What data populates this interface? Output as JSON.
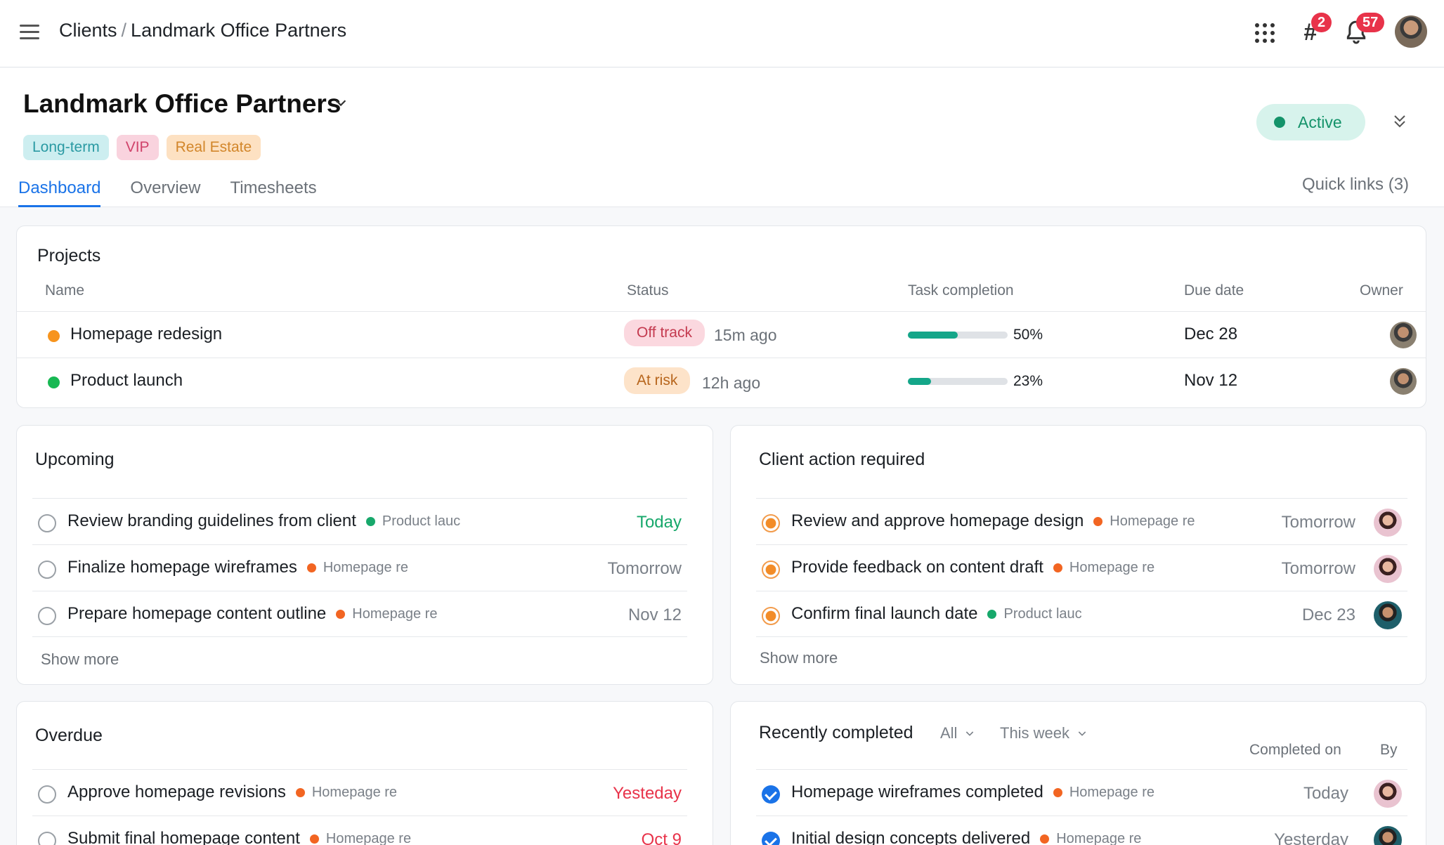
{
  "topbar": {
    "breadcrumb_root": "Clients",
    "breadcrumb_sep": "/",
    "breadcrumb_current": "Landmark Office Partners",
    "hash_badge": "2",
    "notif_badge": "57"
  },
  "header": {
    "title": "Landmark Office Partners",
    "tags": [
      {
        "label": "Long-term",
        "bg": "#cdeef0",
        "color": "#2a9aa3"
      },
      {
        "label": "VIP",
        "bg": "#f9d3de",
        "color": "#d0436b"
      },
      {
        "label": "Real Estate",
        "bg": "#fde1c2",
        "color": "#d2862a"
      }
    ],
    "tabs": [
      "Dashboard",
      "Overview",
      "Timesheets"
    ],
    "status": "Active",
    "quick_links": "Quick links (3)"
  },
  "projects": {
    "title": "Projects",
    "columns": [
      "Name",
      "Status",
      "Task completion",
      "Due date",
      "Owner"
    ],
    "rows": [
      {
        "name": "Homepage redesign",
        "dot": "#f7941d",
        "status": "Off track",
        "status_bg": "#fbd8df",
        "status_color": "#c43a4f",
        "ago": "15m ago",
        "progress": 0.5,
        "pct": "50%",
        "due": "Dec 28"
      },
      {
        "name": "Product launch",
        "dot": "#17b853",
        "status": "At risk",
        "status_bg": "#fde3c9",
        "status_color": "#b7651c",
        "ago": "12h ago",
        "progress": 0.23,
        "pct": "23%",
        "due": "Nov 12"
      }
    ]
  },
  "upcoming": {
    "title": "Upcoming",
    "show_more": "Show more",
    "items": [
      {
        "task": "Review branding guidelines from client",
        "project": "Product lauc",
        "project_color": "#17a86b",
        "when": "Today",
        "when_color": "#17a86b"
      },
      {
        "task": "Finalize homepage wireframes",
        "project": "Homepage re",
        "project_color": "#f26522",
        "when": "Tomorrow",
        "when_color": "#7a8088"
      },
      {
        "task": "Prepare homepage content outline",
        "project": "Homepage re",
        "project_color": "#f26522",
        "when": "Nov 12",
        "when_color": "#7a8088"
      }
    ]
  },
  "client_action": {
    "title": "Client action required",
    "show_more": "Show more",
    "items": [
      {
        "task": "Review and approve homepage design",
        "project": "Homepage re",
        "project_color": "#f26522",
        "when": "Tomorrow",
        "avatar": "f"
      },
      {
        "task": "Provide feedback on content draft",
        "project": "Homepage re",
        "project_color": "#f26522",
        "when": "Tomorrow",
        "avatar": "f"
      },
      {
        "task": "Confirm final launch date",
        "project": "Product lauc",
        "project_color": "#17a86b",
        "when": "Dec 23",
        "avatar": "m"
      }
    ]
  },
  "overdue": {
    "title": "Overdue",
    "items": [
      {
        "task": "Approve homepage revisions",
        "project": "Homepage re",
        "project_color": "#f26522",
        "when": "Yesteday",
        "when_color": "#e8334a"
      },
      {
        "task": "Submit final homepage content",
        "project": "Homepage re",
        "project_color": "#f26522",
        "when": "Oct 9",
        "when_color": "#e8334a"
      }
    ]
  },
  "recent": {
    "title": "Recently completed",
    "filter_all": "All",
    "filter_week": "This week",
    "col_completed": "Completed on",
    "col_by": "By",
    "items": [
      {
        "task": "Homepage wireframes completed",
        "project": "Homepage re",
        "project_color": "#f26522",
        "when": "Today",
        "avatar": "f"
      },
      {
        "task": "Initial design concepts delivered",
        "project": "Homepage re",
        "project_color": "#f26522",
        "when": "Yesterday",
        "avatar": "m"
      }
    ]
  }
}
